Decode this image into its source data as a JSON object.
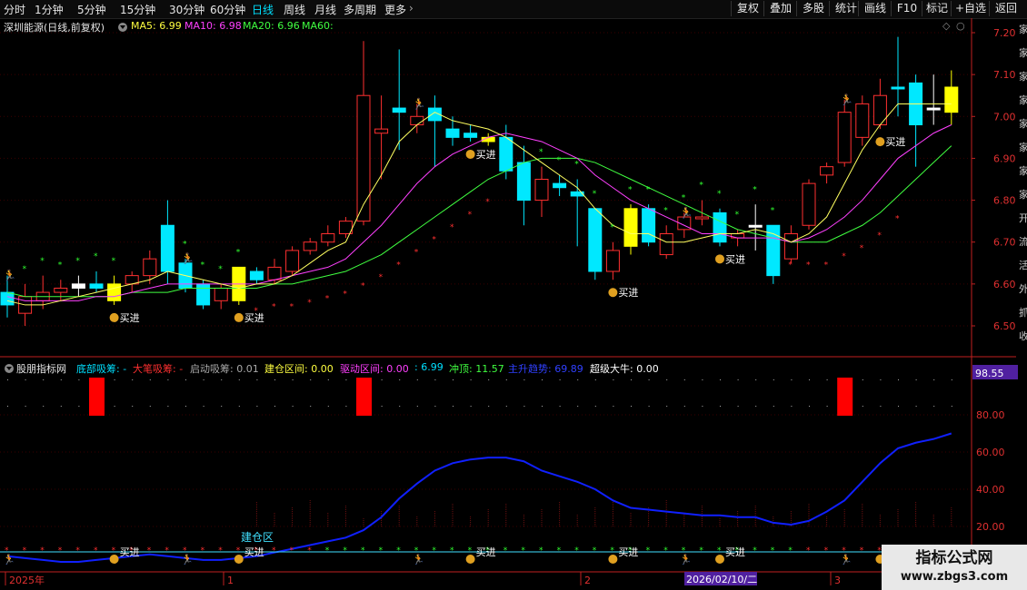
{
  "toolbar": {
    "timeframes": [
      "分时",
      "1分钟",
      "5分钟",
      "15分钟",
      "30分钟",
      "60分钟",
      "日线",
      "周线",
      "月线",
      "多周期",
      "更多"
    ],
    "active": "日线",
    "right_buttons": [
      "复权",
      "叠加",
      "多股",
      "统计",
      "画线",
      "F10",
      "标记",
      "+自选",
      "返回"
    ]
  },
  "main": {
    "stock": "深圳能源(日线,前复权)",
    "ma": [
      {
        "label": "MA5: 6.99",
        "color": "#ffff40"
      },
      {
        "label": "MA10: 6.98",
        "color": "#ff40ff"
      },
      {
        "label": "MA20: 6.96",
        "color": "#40ff40"
      },
      {
        "label": "MA60:",
        "color": "#40ff40"
      }
    ],
    "price_ticks": [
      "7.20",
      "7.10",
      "7.00",
      "6.90",
      "6.80",
      "6.70",
      "6.60",
      "6.50"
    ],
    "buy_label": "买进"
  },
  "indicator": {
    "name": "股朋指标网",
    "legend": [
      {
        "text": "底部吸筹: -",
        "color": "#00e0ff"
      },
      {
        "text": "大笔吸筹: -",
        "color": "#ff3030"
      },
      {
        "text": "启动吸筹: 0.01",
        "color": "#aaaaaa"
      },
      {
        "text": "建仓区间: 0.00",
        "color": "#ffff40"
      },
      {
        "text": "驱动区间: 0.00",
        "color": "#ff40ff"
      },
      {
        "text": ": 6.99",
        "color": "#00e0ff"
      },
      {
        "text": "冲顶: 11.57",
        "color": "#40ff40"
      },
      {
        "text": "主升趋势: 69.89",
        "color": "#3040ff"
      },
      {
        "text": "超级大牛: 0.00",
        "color": "#ffffff"
      }
    ],
    "value_box": "98.55",
    "ticks": [
      "80.00",
      "60.00",
      "40.00",
      "20.00"
    ],
    "zone_label": "建仓区",
    "buy_label": "买进"
  },
  "xaxis": {
    "labels": [
      "2025年",
      "1",
      "2",
      "3"
    ],
    "cursor_date": "2026/02/10/二"
  },
  "side_text": "家家家家家家家家开流活外抓收",
  "watermark": {
    "line1": "指标公式网",
    "line2": "www.zbgs3.com"
  },
  "chart_data": {
    "type": "candlestick",
    "y_range": [
      6.45,
      7.22
    ],
    "candles": [
      {
        "o": 6.55,
        "h": 6.62,
        "l": 6.52,
        "c": 6.58,
        "color": "cyan"
      },
      {
        "o": 6.53,
        "h": 6.6,
        "l": 6.5,
        "c": 6.57,
        "color": "red"
      },
      {
        "o": 6.56,
        "h": 6.62,
        "l": 6.54,
        "c": 6.58,
        "color": "red"
      },
      {
        "o": 6.58,
        "h": 6.61,
        "l": 6.56,
        "c": 6.59,
        "color": "red"
      },
      {
        "o": 6.59,
        "h": 6.62,
        "l": 6.57,
        "c": 6.6,
        "color": "white"
      },
      {
        "o": 6.6,
        "h": 6.63,
        "l": 6.58,
        "c": 6.59,
        "color": "cyan"
      },
      {
        "o": 6.56,
        "h": 6.62,
        "l": 6.55,
        "c": 6.6,
        "color": "yellow"
      },
      {
        "o": 6.6,
        "h": 6.63,
        "l": 6.58,
        "c": 6.62,
        "color": "red"
      },
      {
        "o": 6.62,
        "h": 6.68,
        "l": 6.6,
        "c": 6.66,
        "color": "red"
      },
      {
        "o": 6.74,
        "h": 6.8,
        "l": 6.6,
        "c": 6.63,
        "color": "cyan"
      },
      {
        "o": 6.65,
        "h": 6.66,
        "l": 6.58,
        "c": 6.59,
        "color": "cyan"
      },
      {
        "o": 6.6,
        "h": 6.61,
        "l": 6.54,
        "c": 6.55,
        "color": "cyan"
      },
      {
        "o": 6.56,
        "h": 6.6,
        "l": 6.54,
        "c": 6.59,
        "color": "red"
      },
      {
        "o": 6.56,
        "h": 6.64,
        "l": 6.55,
        "c": 6.64,
        "color": "yellow"
      },
      {
        "o": 6.63,
        "h": 6.64,
        "l": 6.6,
        "c": 6.61,
        "color": "cyan"
      },
      {
        "o": 6.61,
        "h": 6.66,
        "l": 6.6,
        "c": 6.64,
        "color": "red"
      },
      {
        "o": 6.63,
        "h": 6.69,
        "l": 6.62,
        "c": 6.68,
        "color": "red"
      },
      {
        "o": 6.68,
        "h": 6.71,
        "l": 6.67,
        "c": 6.7,
        "color": "red"
      },
      {
        "o": 6.7,
        "h": 6.74,
        "l": 6.69,
        "c": 6.72,
        "color": "red"
      },
      {
        "o": 6.72,
        "h": 6.76,
        "l": 6.71,
        "c": 6.75,
        "color": "red"
      },
      {
        "o": 6.75,
        "h": 7.18,
        "l": 6.74,
        "c": 7.05,
        "color": "red"
      },
      {
        "o": 6.96,
        "h": 7.05,
        "l": 6.85,
        "c": 6.97,
        "color": "red"
      },
      {
        "o": 7.02,
        "h": 7.16,
        "l": 6.92,
        "c": 7.01,
        "color": "cyan"
      },
      {
        "o": 6.98,
        "h": 7.03,
        "l": 6.96,
        "c": 7.0,
        "color": "red"
      },
      {
        "o": 6.99,
        "h": 7.05,
        "l": 6.88,
        "c": 7.02,
        "color": "cyan"
      },
      {
        "o": 6.97,
        "h": 7.0,
        "l": 6.93,
        "c": 6.95,
        "color": "cyan"
      },
      {
        "o": 6.96,
        "h": 6.98,
        "l": 6.94,
        "c": 6.95,
        "color": "cyan"
      },
      {
        "o": 6.95,
        "h": 6.96,
        "l": 6.93,
        "c": 6.94,
        "color": "yellow"
      },
      {
        "o": 6.95,
        "h": 6.98,
        "l": 6.85,
        "c": 6.87,
        "color": "cyan"
      },
      {
        "o": 6.89,
        "h": 6.93,
        "l": 6.74,
        "c": 6.8,
        "color": "cyan"
      },
      {
        "o": 6.8,
        "h": 6.88,
        "l": 6.76,
        "c": 6.85,
        "color": "red"
      },
      {
        "o": 6.84,
        "h": 6.86,
        "l": 6.81,
        "c": 6.83,
        "color": "cyan"
      },
      {
        "o": 6.82,
        "h": 6.85,
        "l": 6.69,
        "c": 6.81,
        "color": "cyan"
      },
      {
        "o": 6.78,
        "h": 6.78,
        "l": 6.61,
        "c": 6.63,
        "color": "cyan"
      },
      {
        "o": 6.63,
        "h": 6.7,
        "l": 6.61,
        "c": 6.68,
        "color": "red"
      },
      {
        "o": 6.69,
        "h": 6.79,
        "l": 6.67,
        "c": 6.78,
        "color": "yellow"
      },
      {
        "o": 6.78,
        "h": 6.79,
        "l": 6.69,
        "c": 6.7,
        "color": "cyan"
      },
      {
        "o": 6.67,
        "h": 6.74,
        "l": 6.66,
        "c": 6.72,
        "color": "red"
      },
      {
        "o": 6.73,
        "h": 6.77,
        "l": 6.71,
        "c": 6.76,
        "color": "red"
      },
      {
        "o": 6.76,
        "h": 6.8,
        "l": 6.74,
        "c": 6.76,
        "color": "red"
      },
      {
        "o": 6.77,
        "h": 6.78,
        "l": 6.69,
        "c": 6.7,
        "color": "cyan"
      },
      {
        "o": 6.71,
        "h": 6.73,
        "l": 6.69,
        "c": 6.72,
        "color": "red"
      },
      {
        "o": 6.74,
        "h": 6.79,
        "l": 6.68,
        "c": 6.74,
        "color": "white"
      },
      {
        "o": 6.74,
        "h": 6.74,
        "l": 6.6,
        "c": 6.62,
        "color": "cyan"
      },
      {
        "o": 6.66,
        "h": 6.74,
        "l": 6.65,
        "c": 6.72,
        "color": "red"
      },
      {
        "o": 6.74,
        "h": 6.85,
        "l": 6.73,
        "c": 6.84,
        "color": "red"
      },
      {
        "o": 6.86,
        "h": 6.89,
        "l": 6.84,
        "c": 6.88,
        "color": "red"
      },
      {
        "o": 6.89,
        "h": 7.04,
        "l": 6.88,
        "c": 7.01,
        "color": "red"
      },
      {
        "o": 6.95,
        "h": 7.05,
        "l": 6.93,
        "c": 7.03,
        "color": "red"
      },
      {
        "o": 6.98,
        "h": 7.09,
        "l": 6.97,
        "c": 7.05,
        "color": "red"
      },
      {
        "o": 7.07,
        "h": 7.19,
        "l": 7.0,
        "c": 7.07,
        "color": "cyan"
      },
      {
        "o": 7.08,
        "h": 7.1,
        "l": 6.88,
        "c": 6.98,
        "color": "cyan"
      },
      {
        "o": 7.02,
        "h": 7.1,
        "l": 6.98,
        "c": 7.02,
        "color": "white"
      },
      {
        "o": 7.01,
        "h": 7.11,
        "l": 6.98,
        "c": 7.07,
        "color": "yellow"
      }
    ],
    "ma5": [
      6.56,
      6.55,
      6.55,
      6.56,
      6.57,
      6.58,
      6.59,
      6.6,
      6.61,
      6.63,
      6.62,
      6.61,
      6.6,
      6.59,
      6.6,
      6.6,
      6.62,
      6.65,
      6.68,
      6.7,
      6.79,
      6.86,
      6.94,
      6.98,
      7.01,
      6.99,
      6.98,
      6.97,
      6.95,
      6.92,
      6.89,
      6.86,
      6.83,
      6.78,
      6.74,
      6.72,
      6.72,
      6.7,
      6.7,
      6.71,
      6.72,
      6.72,
      6.73,
      6.72,
      6.7,
      6.72,
      6.76,
      6.84,
      6.92,
      6.98,
      7.03,
      7.03,
      7.03,
      7.03
    ],
    "ma10": [
      6.57,
      6.56,
      6.56,
      6.56,
      6.56,
      6.57,
      6.57,
      6.58,
      6.59,
      6.6,
      6.6,
      6.6,
      6.6,
      6.6,
      6.6,
      6.61,
      6.62,
      6.63,
      6.64,
      6.66,
      6.7,
      6.74,
      6.79,
      6.84,
      6.88,
      6.91,
      6.93,
      6.95,
      6.96,
      6.95,
      6.94,
      6.92,
      6.9,
      6.86,
      6.83,
      6.8,
      6.78,
      6.76,
      6.74,
      6.72,
      6.72,
      6.71,
      6.71,
      6.71,
      6.7,
      6.71,
      6.73,
      6.76,
      6.8,
      6.85,
      6.9,
      6.93,
      6.96,
      6.98
    ],
    "ma20": [
      6.58,
      6.57,
      6.57,
      6.57,
      6.57,
      6.57,
      6.57,
      6.58,
      6.58,
      6.58,
      6.59,
      6.59,
      6.59,
      6.59,
      6.59,
      6.6,
      6.6,
      6.61,
      6.62,
      6.63,
      6.65,
      6.67,
      6.7,
      6.73,
      6.76,
      6.79,
      6.82,
      6.85,
      6.87,
      6.89,
      6.9,
      6.9,
      6.9,
      6.89,
      6.87,
      6.85,
      6.83,
      6.81,
      6.79,
      6.77,
      6.75,
      6.73,
      6.72,
      6.71,
      6.7,
      6.7,
      6.7,
      6.72,
      6.74,
      6.77,
      6.81,
      6.85,
      6.89,
      6.93
    ],
    "trend_line": [
      4,
      3,
      2,
      1,
      1,
      2,
      3,
      4,
      5,
      4,
      3,
      2,
      2,
      3,
      4,
      6,
      8,
      10,
      12,
      14,
      18,
      25,
      35,
      43,
      50,
      54,
      56,
      57,
      57,
      55,
      50,
      47,
      44,
      40,
      34,
      30,
      29,
      28,
      27,
      26,
      26,
      25,
      25,
      22,
      21,
      23,
      28,
      34,
      44,
      54,
      62,
      65,
      67,
      70
    ]
  }
}
